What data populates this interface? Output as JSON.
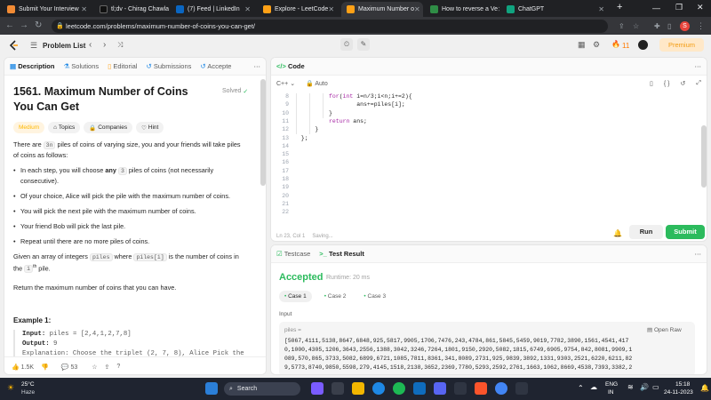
{
  "browser": {
    "tabs": [
      {
        "title": "Submit Your Interview",
        "color": "#f28b34"
      },
      {
        "title": "tl;dv - Chirag Chawla",
        "color": "#202124"
      },
      {
        "title": "(7) Feed | LinkedIn",
        "color": "#0a66c2"
      },
      {
        "title": "Explore - LeetCode",
        "color": "#ffa116"
      },
      {
        "title": "Maximum Number o",
        "color": "#ffa116"
      },
      {
        "title": "How to reverse a Ve",
        "color": "#2f8d46"
      },
      {
        "title": "ChatGPT",
        "color": "#10a37f"
      }
    ],
    "url": "leetcode.com/problems/maximum-number-of-coins-you-can-get/",
    "new_tab": "+",
    "profile_initial": "S"
  },
  "header": {
    "problem_list": "Problem List",
    "streak": "11",
    "premium": "Premium"
  },
  "left": {
    "tabs": [
      "Description",
      "Solutions",
      "Editorial",
      "Submissions",
      "Accepte"
    ],
    "title": "1561. Maximum Number of Coins You Can Get",
    "solved": "Solved",
    "difficulty": "Medium",
    "chips": [
      "Topics",
      "Companies",
      "Hint"
    ],
    "p1a": "There are ",
    "p1code": "3n",
    "p1b": " piles of coins of varying size, you and your friends will take piles of coins as follows:",
    "b1a": "In each step, you will choose ",
    "b1bold": "any",
    "b1code": "3",
    "b1b": " piles of coins (not necessarily consecutive).",
    "b2": "Of your choice, Alice will pick the pile with the maximum number of coins.",
    "b3": "You will pick the next pile with the maximum number of coins.",
    "b4": "Your friend Bob will pick the last pile.",
    "b5": "Repeat until there are no more piles of coins.",
    "p2a": "Given an array of integers ",
    "p2code1": "piles",
    "p2b": " where ",
    "p2code2": "piles[i]",
    "p2c": " is the number of coins in the ",
    "p2sup": "th",
    "p2d": " pile.",
    "p2i": "i",
    "p3": "Return the maximum number of coins that you can have.",
    "example_title": "Example 1:",
    "ex_input_label": "Input:",
    "ex_input": "piles = [2,4,1,2,7,8]",
    "ex_output_label": "Output:",
    "ex_output": "9",
    "ex_expl": "Explanation: Choose the triplet (2, 7, 8), Alice Pick the",
    "likes": "1.5K",
    "comments": "53"
  },
  "code": {
    "tab": "Code",
    "language": "C++",
    "mode": "Auto",
    "lines": [
      {
        "n": "8",
        "text": "for(int i=n/3;i<n;i+=2){"
      },
      {
        "n": "9",
        "text": "ans+=piles[i];"
      },
      {
        "n": "10",
        "text": "}"
      },
      {
        "n": "11",
        "text": "return ans;"
      },
      {
        "n": "12",
        "text": "}"
      },
      {
        "n": "13",
        "text": "};"
      },
      {
        "n": "14",
        "text": ""
      },
      {
        "n": "15",
        "text": ""
      },
      {
        "n": "16",
        "text": ""
      },
      {
        "n": "17",
        "text": ""
      },
      {
        "n": "18",
        "text": ""
      },
      {
        "n": "19",
        "text": ""
      },
      {
        "n": "20",
        "text": ""
      },
      {
        "n": "21",
        "text": ""
      },
      {
        "n": "22",
        "text": ""
      }
    ],
    "status": "Ln 23, Col 1",
    "saving": "Saving...",
    "run": "Run",
    "submit": "Submit"
  },
  "result": {
    "tab_testcase": "Testcase",
    "tab_result": "Test Result",
    "accepted": "Accepted",
    "runtime": "Runtime: 20 ms",
    "cases": [
      "Case 1",
      "Case 2",
      "Case 3"
    ],
    "input_label": "Input",
    "var_name": "piles =",
    "open_raw": "Open Raw",
    "value_lines": [
      "[5067,4111,5138,8647,6848,925,5817,9905,1706,7476,243,4784,861,5845,5459,9019,7782,3890,1561,4541,417",
      "0,1000,4305,1206,3643,2556,1388,3042,3246,7264,1801,9150,2920,5082,1815,6749,6905,9754,842,8081,9909,1",
      "089,570,865,3733,5082,6899,6721,1085,7811,8361,341,8089,2731,925,9839,3892,1331,9303,2521,6220,6211,82",
      "9,5773,8740,9850,5598,279,4145,1518,2138,3652,2369,7780,5293,2592,2761,1663,1062,8669,4538,7393,3382,2"
    ]
  },
  "taskbar": {
    "temp": "25°C",
    "weather": "Haze",
    "search": "Search",
    "lang1": "ENG",
    "lang2": "IN",
    "time": "15:18",
    "date": "24-11-2023"
  }
}
